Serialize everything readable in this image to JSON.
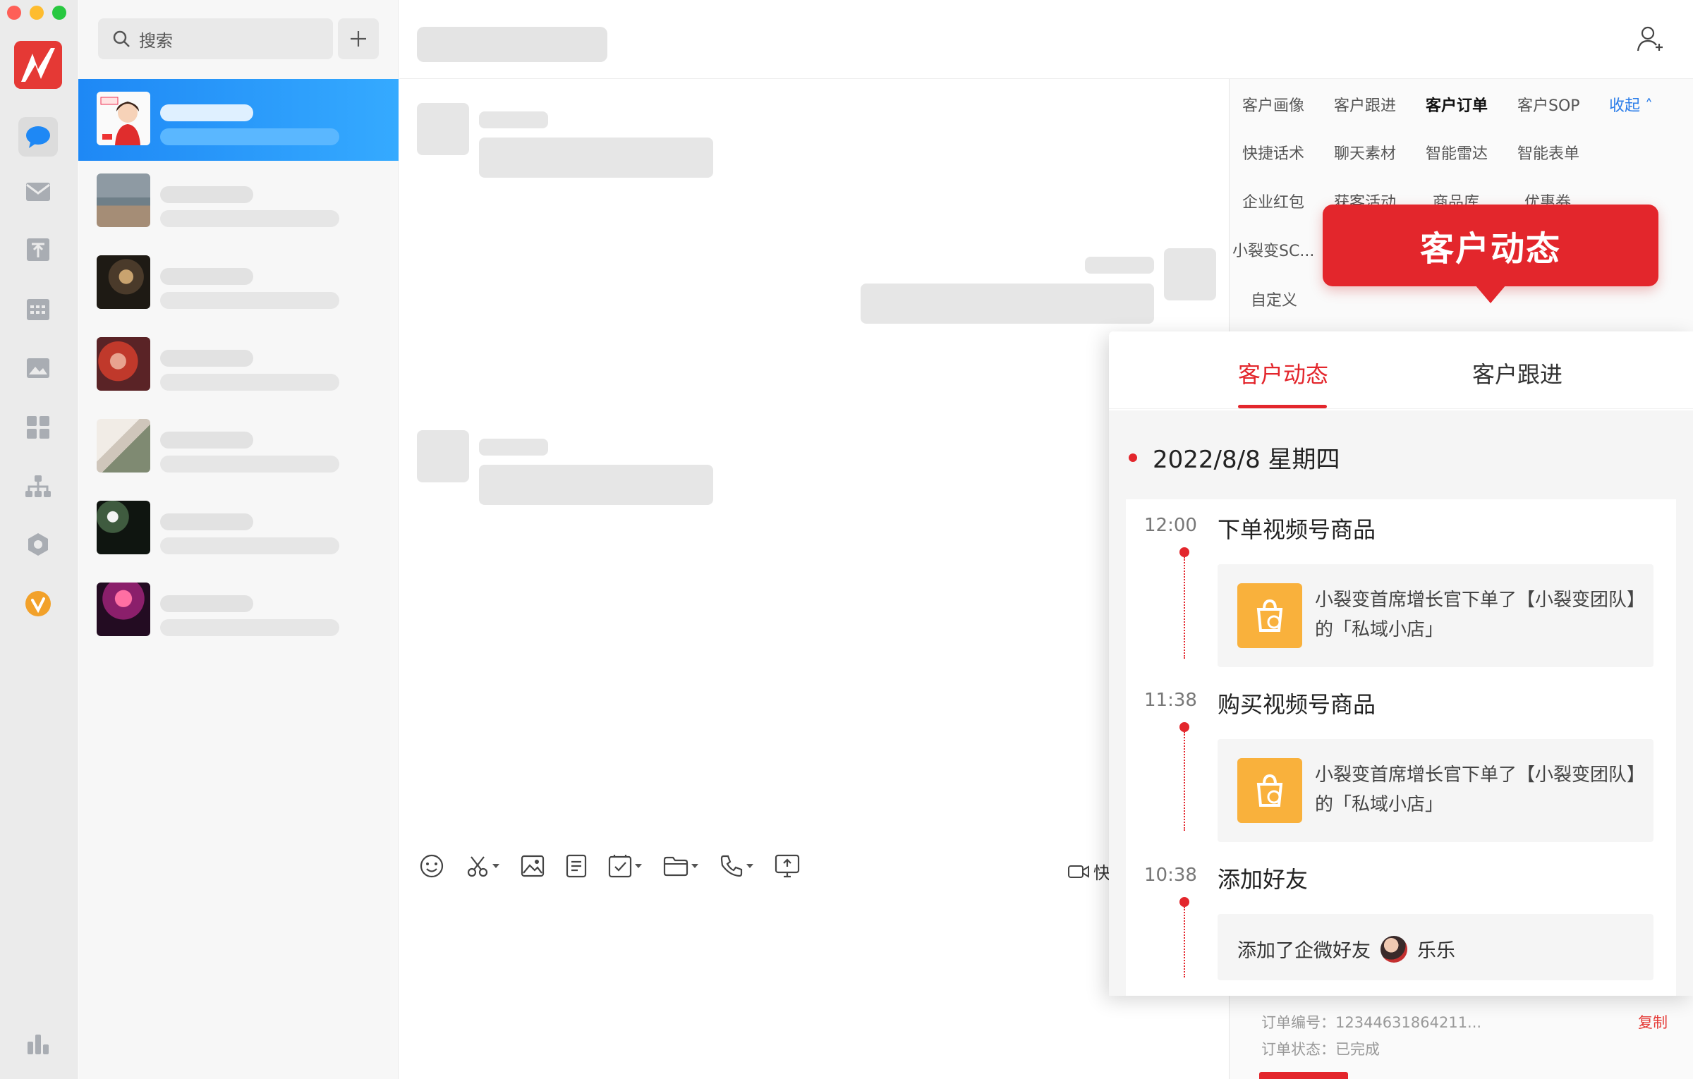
{
  "window": {
    "traffic_lights": [
      "close",
      "minimize",
      "zoom"
    ]
  },
  "rail": {
    "items": [
      {
        "name": "messages-icon",
        "active": true
      },
      {
        "name": "mail-icon"
      },
      {
        "name": "docs-icon"
      },
      {
        "name": "calendar-icon"
      },
      {
        "name": "photo-icon"
      },
      {
        "name": "workbench-icon"
      },
      {
        "name": "org-icon"
      },
      {
        "name": "meeting-icon"
      },
      {
        "name": "mini-app-icon"
      }
    ],
    "bottom": "collapse-sidebar-icon"
  },
  "search": {
    "placeholder": "搜索"
  },
  "chat_list": {
    "conversations": [
      {
        "avatar": "cartoon-girl",
        "active": true
      },
      {
        "avatar": "beach"
      },
      {
        "avatar": "dark-portrait"
      },
      {
        "avatar": "red-flowers"
      },
      {
        "avatar": "white-room"
      },
      {
        "avatar": "night-light"
      },
      {
        "avatar": "pink-concert"
      }
    ]
  },
  "plugin_menu": {
    "row1": [
      "客户画像",
      "客户跟进",
      "客户订单",
      "客户SOP"
    ],
    "collapse": "收起",
    "row2": [
      "快捷话术",
      "聊天素材",
      "智能雷达",
      "智能表单"
    ],
    "row3": [
      "企业红包",
      "获客活动",
      "商品库",
      "优惠券"
    ],
    "row4": [
      "小裂变SC...",
      "自定义"
    ],
    "selected": "客户订单"
  },
  "callout": {
    "label": "客户动态"
  },
  "activity_card": {
    "tabs": [
      "客户动态",
      "客户跟进"
    ],
    "active_tab": "客户动态",
    "date": "2022/8/8 星期四",
    "events": [
      {
        "time": "12:00",
        "title": "下单视频号商品",
        "detail": "小裂变首席增长官下单了【小裂变团队】的「私域小店」"
      },
      {
        "time": "11:38",
        "title": "购买视频号商品",
        "detail": "小裂变首席增长官下单了【小裂变团队】的「私域小店」"
      },
      {
        "time": "10:38",
        "title": "添加好友",
        "detail_prefix": "添加了企微好友",
        "friend_name": "乐乐"
      }
    ]
  },
  "order": {
    "number_label": "订单编号：12344631864211...",
    "status_label": "订单状态：已完成",
    "copy": "复制"
  },
  "toolbar": {
    "video_quick": "快"
  },
  "colors": {
    "accent_red": "#e3262c",
    "active_blue": "#1e88f5",
    "order_orange": "#f9b13c"
  }
}
